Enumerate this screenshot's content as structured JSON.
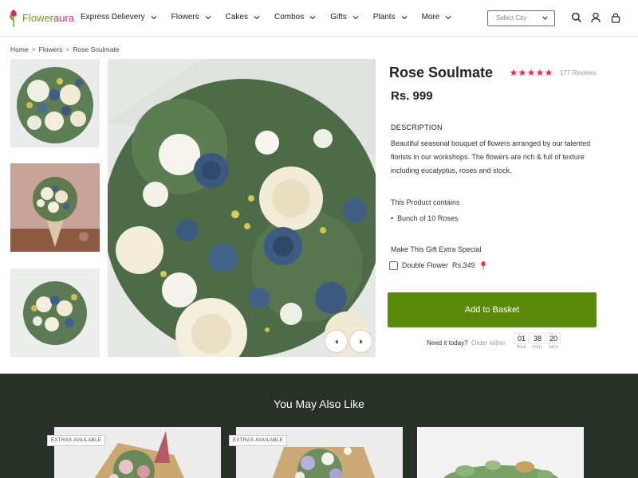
{
  "header": {
    "logo": {
      "part1": "Flower",
      "part2": "aura"
    },
    "nav": [
      "Express Delievery",
      "Flowers",
      "Cakes",
      "Combos",
      "Gifts",
      "Plants",
      "More"
    ],
    "city_placeholder": "Select City",
    "icons": [
      "search-icon",
      "user-icon",
      "lock-icon"
    ]
  },
  "breadcrumb": [
    "Home",
    "Flowers",
    "Rose Soulmate"
  ],
  "product": {
    "title": "Rose Soulmate",
    "rating": 5,
    "reviews": "177 Reviews",
    "price": "Rs. 999",
    "description_heading": "DESCRIPTION",
    "description": "Beautiful seasonal bouquet of flowers arranged by our talented florists in our workshops. The flowers are rich & full of texture including eucalyptus, roses and stock.",
    "contains_heading": "This Product contains",
    "contains_items": [
      "Bunch of 10 Roses"
    ],
    "special_heading": "Make This Gift Extra Special",
    "addon": {
      "label": "Double Flower",
      "price": "Rs.349"
    },
    "basket_label": "Add to Basket",
    "need_it": "Need it today?",
    "order_within": "Order within",
    "timer": [
      {
        "num": "01",
        "unit": "hour"
      },
      {
        "num": "38",
        "unit": "mins"
      },
      {
        "num": "20",
        "unit": "secs"
      }
    ]
  },
  "also_like": {
    "heading": "You May Also Like",
    "badge": "EXTRAS AVAILABLE"
  },
  "colors": {
    "accent_green": "#5c8a0d",
    "star_pink": "#e8315b",
    "dark_section": "#283128"
  }
}
